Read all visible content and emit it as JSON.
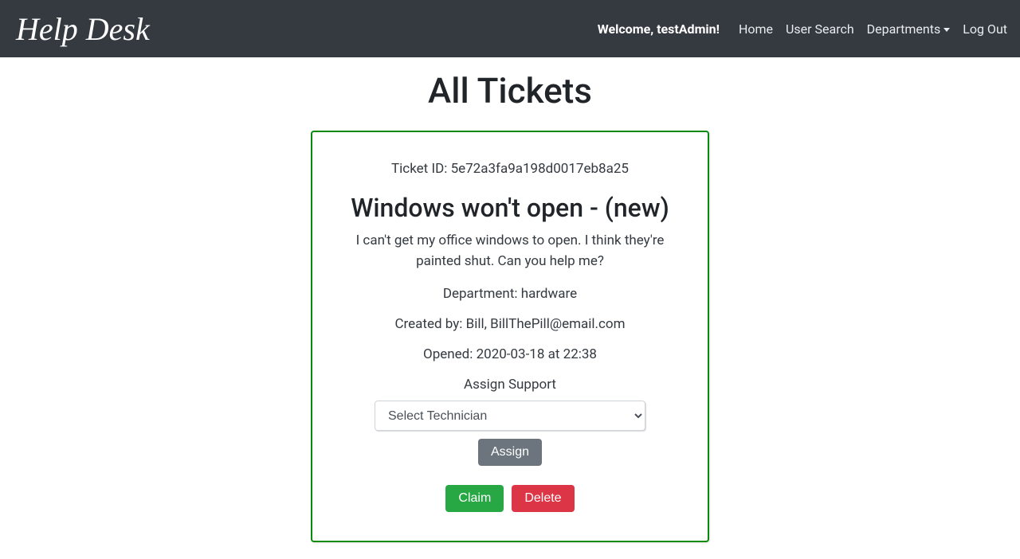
{
  "brand": "Help Desk",
  "welcome": "Welcome, testAdmin!",
  "nav": {
    "home": "Home",
    "user_search": "User Search",
    "departments": "Departments",
    "logout": "Log Out"
  },
  "page_title": "All Tickets",
  "ticket": {
    "id_line": "Ticket ID: 5e72a3fa9a198d0017eb8a25",
    "title": "Windows won't open - (new)",
    "description": "I can't get my office windows to open. I think they're painted shut. Can you help me?",
    "department_line": "Department: hardware",
    "created_by_line": "Created by: Bill, BillThePill@email.com",
    "opened_line": "Opened: 2020-03-18 at 22:38",
    "assign_label": "Assign Support",
    "select_placeholder": "Select Technician",
    "assign_btn": "Assign",
    "claim_btn": "Claim",
    "delete_btn": "Delete"
  }
}
